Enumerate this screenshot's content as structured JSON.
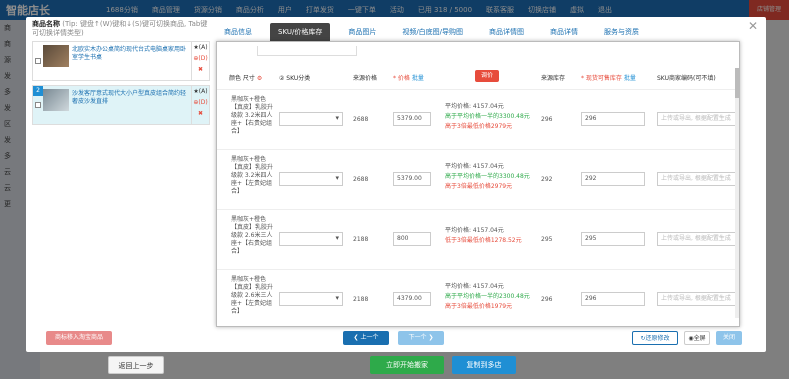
{
  "app": {
    "logo": "智能店长",
    "nav": [
      "1688分销",
      "商品管理",
      "货源分销",
      "商品分析",
      "用户",
      "打单发货",
      "一键下单",
      "活动",
      "已用 318 / 5000",
      "联系客服",
      "切换店铺",
      "虚拟",
      "退出"
    ],
    "right_btn": "店铺管理",
    "sidebar": [
      "商",
      "商",
      "源",
      "发",
      "多",
      "发",
      "区",
      "发",
      "多",
      "云",
      "云",
      "更"
    ],
    "bottom_buttons": {
      "prev_step": "返回上一步",
      "start": "立即开始搬家",
      "multi": "复制到多店"
    }
  },
  "modal": {
    "left": {
      "title_bold": "商品名称",
      "title_hint": "(Tip: 键盘↑(W)键和↓(S)键可切换商品, Tab键可切换详情类型)",
      "items": [
        {
          "num": "",
          "text": "北欧实木办公桌简约现代台式电脑桌家用卧室学生书桌",
          "acts": [
            "★(A)",
            "⊕(D)",
            "✖"
          ]
        },
        {
          "num": "2",
          "text": "沙发客厅意式现代大小户型真皮组合简约轻奢皮沙发直排",
          "acts": [
            "★(A)",
            "⊕(D)",
            "✖"
          ]
        }
      ],
      "batch_btn": "商标移入淘宝商品"
    },
    "tabs": [
      "商品信息",
      "SKU/价格库存",
      "商品图片",
      "视频/白底图/导购图",
      "商品详情图",
      "商品详情",
      "服务与资质"
    ],
    "active_tab": 1,
    "table": {
      "headers": {
        "color_size": "颜色 尺寸",
        "sku_cat": "② SKU分类",
        "source_price": "来源价格",
        "price": "* 价格",
        "batch1": "批量",
        "btn_red": "调价",
        "source_stock": "来源库存",
        "current_stock": "* 现货可售库存",
        "batch2": "批量",
        "sku_code": "SKU商家编码(可不填)"
      },
      "rows": [
        {
          "color": "黑咖灰+橙色【真皮】乳胶升级款 3.2米四人座+【右贵妃组合】",
          "source_price": "2688",
          "price": "5379.00",
          "avg": "平均价格: 4157.04元",
          "g": "高于平均价格一半的3300.48元",
          "r": "高于3倍最低价格2979元",
          "source_stock": "296",
          "stock": "296",
          "code_ph": "上传或导出, 根据配置生成"
        },
        {
          "color": "黑咖灰+橙色【真皮】乳胶升级款 3.2米四人座+【左贵妃组合】",
          "source_price": "2688",
          "price": "5379.00",
          "avg": "平均价格: 4157.04元",
          "g": "高于平均价格一半的3300.48元",
          "r": "高于3倍最低价格2979元",
          "source_stock": "292",
          "stock": "292",
          "code_ph": "上传或导出, 根据配置生成"
        },
        {
          "color": "黑咖灰+橙色【真皮】乳胶升级款 2.6米三人座+【右贵妃组合】",
          "source_price": "2188",
          "price": "800",
          "avg": "平均价格: 4157.04元",
          "g": "",
          "r": "低于3倍最低价格1278.52元",
          "source_stock": "295",
          "stock": "295",
          "code_ph": "上传或导出, 根据配置生成"
        },
        {
          "color": "黑咖灰+橙色【真皮】乳胶升级款 2.6米三人座+【左贵妃组合】",
          "source_price": "2188",
          "price": "4379.00",
          "avg": "平均价格: 4157.04元",
          "g": "高于平均价格一半的2300.48元",
          "r": "高于3倍最低价格1979元",
          "source_stock": "296",
          "stock": "296",
          "code_ph": "上传或导出, 根据配置生成"
        }
      ]
    },
    "footer": {
      "prev": "❮ 上一个",
      "next": "下一个 ❯",
      "restore": "还原修改",
      "fullscreen": "全屏",
      "close": "关闭"
    }
  }
}
